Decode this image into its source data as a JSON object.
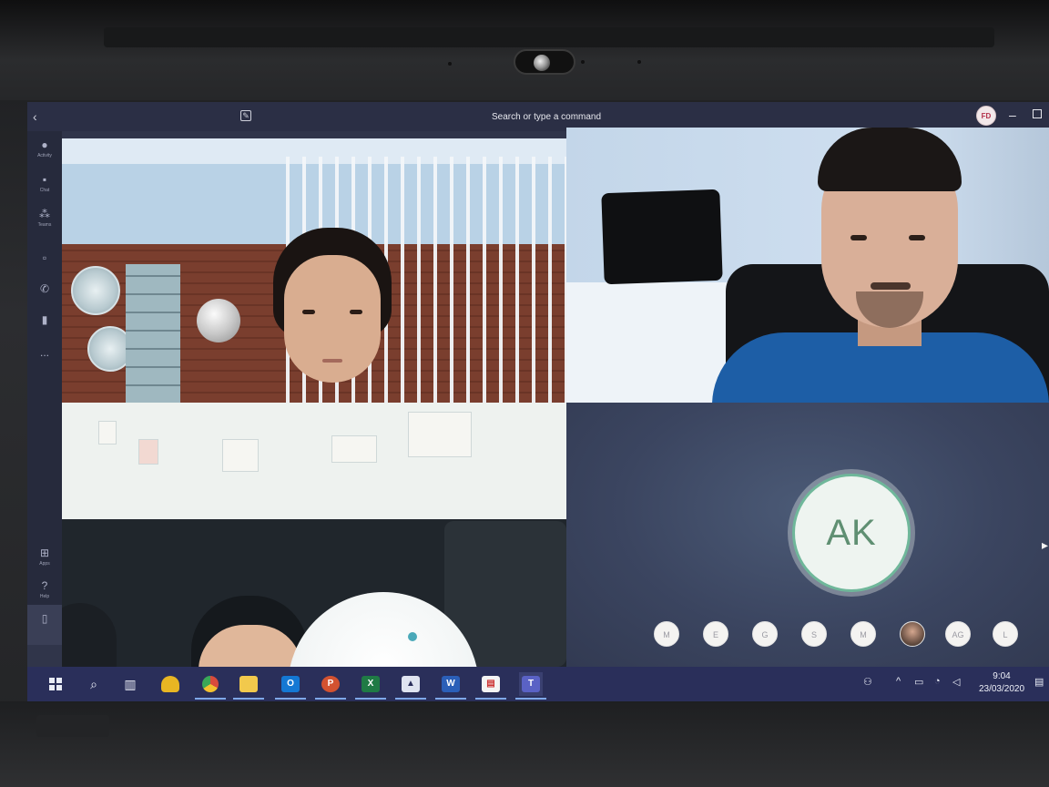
{
  "titlebar": {
    "search_placeholder": "Search or type a command",
    "user_initials": "FD"
  },
  "rail": {
    "items": [
      {
        "label": "Activity",
        "icon": "bell-icon"
      },
      {
        "label": "Chat",
        "icon": "chat-icon"
      },
      {
        "label": "Teams",
        "icon": "teams-icon"
      },
      {
        "label": "Calendar",
        "icon": "calendar-icon"
      },
      {
        "label": "Calls",
        "icon": "phone-icon"
      },
      {
        "label": "Files",
        "icon": "file-icon"
      },
      {
        "label": "...",
        "icon": "more-icon"
      }
    ],
    "bottom_items": [
      {
        "label": "Apps",
        "icon": "apps-icon"
      },
      {
        "label": "Help",
        "icon": "help-icon"
      },
      {
        "label": "",
        "icon": "phone-device-icon"
      }
    ]
  },
  "call": {
    "participant_initials": "AK",
    "roster": [
      "M",
      "E",
      "G",
      "S",
      "M",
      "",
      "AG",
      "L"
    ]
  },
  "taskbar": {
    "apps": [
      "start-icon",
      "search-icon",
      "task-view-icon",
      "notification-bell-icon",
      "chrome-icon",
      "file-explorer-icon",
      "outlook-icon",
      "powerpoint-icon",
      "excel-icon",
      "photos-icon",
      "word-icon",
      "pdf-icon",
      "teams-icon"
    ],
    "time": "9:04",
    "date": "23/03/2020"
  },
  "colors": {
    "titlebar_bg": "#2b2f45",
    "taskbar_bg": "#2a2f5a",
    "avatar_ring": "#6fb79a"
  }
}
